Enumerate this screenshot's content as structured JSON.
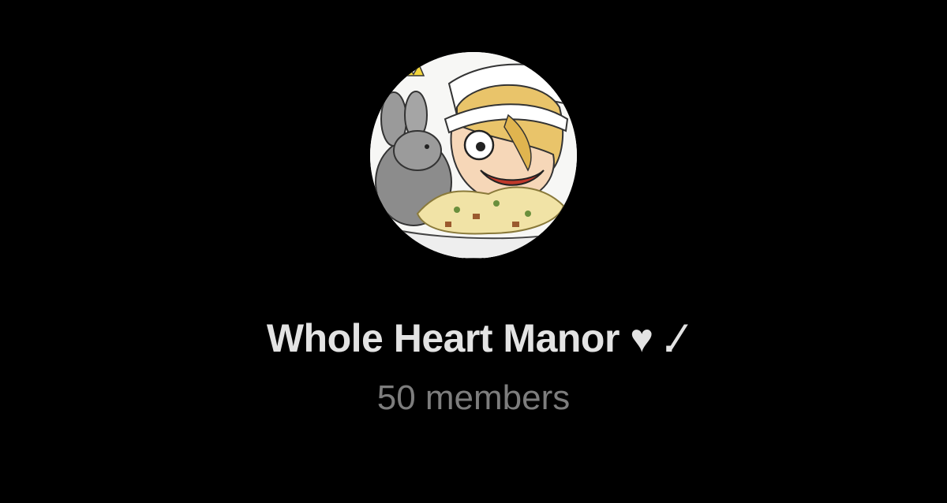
{
  "group": {
    "name": "Whole Heart Manor ♥ .⁄",
    "member_count": "50 members",
    "avatar_icon": "group-avatar-illustration"
  },
  "colors": {
    "background": "#000000",
    "title": "#e3e3e3",
    "subtitle": "#7d7d7d"
  }
}
